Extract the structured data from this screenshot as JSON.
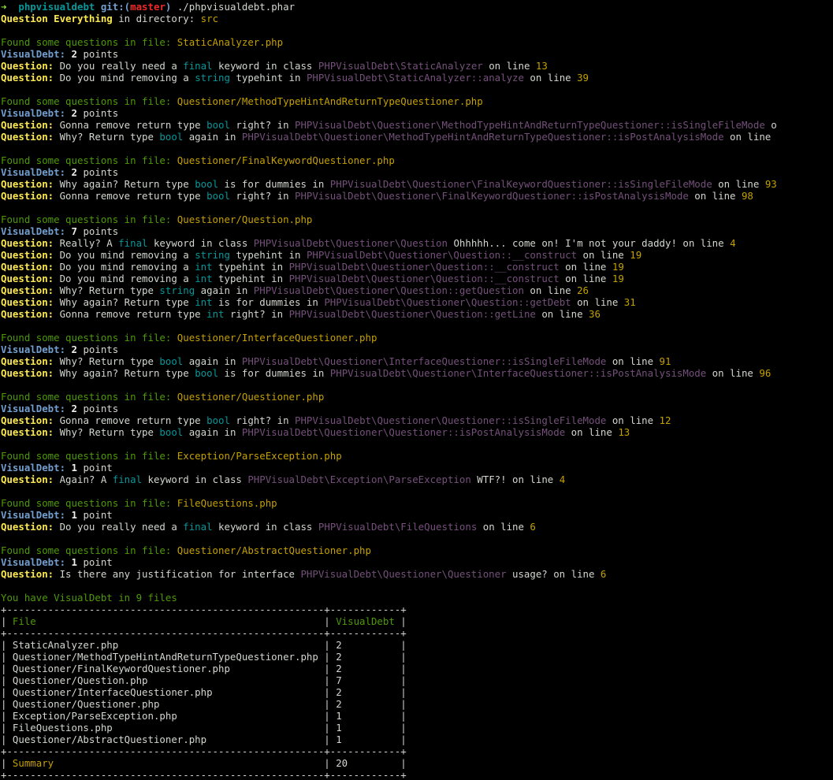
{
  "colors": {
    "background": "#000000",
    "default": "#d3d7cf",
    "green": "#8ae234",
    "dark_green": "#4e9a06",
    "gold": "#c4a000",
    "yellow": "#fce94f",
    "blue": "#729fcf",
    "cyan": "#06989a",
    "purple": "#75507b",
    "red": "#ef2929",
    "white": "#eeeeec"
  },
  "lines": [
    [
      {
        "t": "➜  ",
        "c": "green",
        "b": true
      },
      {
        "t": "phpvisualdebt",
        "c": "cyan",
        "b": true
      },
      {
        "t": " git:(",
        "c": "blue",
        "b": true
      },
      {
        "t": "master",
        "c": "red",
        "b": true
      },
      {
        "t": ")",
        "c": "blue",
        "b": true
      },
      {
        "t": " ./phpvisualdebt.phar",
        "c": "default"
      }
    ],
    [
      {
        "t": "Question Everything",
        "c": "yellow",
        "b": true
      },
      {
        "t": " in directory: ",
        "c": "default"
      },
      {
        "t": "src",
        "c": "gold"
      }
    ],
    [],
    [
      {
        "t": "Found some questions in file: ",
        "c": "dgreen"
      },
      {
        "t": "StaticAnalyzer.php",
        "c": "gold"
      }
    ],
    [
      {
        "t": "VisualDebt:",
        "c": "blue",
        "b": true
      },
      {
        "t": " ",
        "c": "default"
      },
      {
        "t": "2",
        "c": "white",
        "b": true
      },
      {
        "t": " points",
        "c": "default"
      }
    ],
    [
      {
        "t": "Question:",
        "c": "yellow",
        "b": true
      },
      {
        "t": " Do you really need a ",
        "c": "default"
      },
      {
        "t": "final",
        "c": "cyan"
      },
      {
        "t": " keyword in class ",
        "c": "default"
      },
      {
        "t": "PHPVisualDebt\\StaticAnalyzer",
        "c": "purple"
      },
      {
        "t": " on line ",
        "c": "default"
      },
      {
        "t": "13",
        "c": "gold"
      }
    ],
    [
      {
        "t": "Question:",
        "c": "yellow",
        "b": true
      },
      {
        "t": " Do you mind removing a ",
        "c": "default"
      },
      {
        "t": "string",
        "c": "cyan"
      },
      {
        "t": " typehint in ",
        "c": "default"
      },
      {
        "t": "PHPVisualDebt\\StaticAnalyzer::analyze",
        "c": "purple"
      },
      {
        "t": " on line ",
        "c": "default"
      },
      {
        "t": "39",
        "c": "gold"
      }
    ],
    [],
    [
      {
        "t": "Found some questions in file: ",
        "c": "dgreen"
      },
      {
        "t": "Questioner/MethodTypeHintAndReturnTypeQuestioner.php",
        "c": "gold"
      }
    ],
    [
      {
        "t": "VisualDebt:",
        "c": "blue",
        "b": true
      },
      {
        "t": " ",
        "c": "default"
      },
      {
        "t": "2",
        "c": "white",
        "b": true
      },
      {
        "t": " points",
        "c": "default"
      }
    ],
    [
      {
        "t": "Question:",
        "c": "yellow",
        "b": true
      },
      {
        "t": " Gonna remove return type ",
        "c": "default"
      },
      {
        "t": "bool",
        "c": "cyan"
      },
      {
        "t": " right? in ",
        "c": "default"
      },
      {
        "t": "PHPVisualDebt\\Questioner\\MethodTypeHintAndReturnTypeQuestioner::isSingleFileMode",
        "c": "purple"
      },
      {
        "t": " o",
        "c": "default"
      }
    ],
    [
      {
        "t": "Question:",
        "c": "yellow",
        "b": true
      },
      {
        "t": " Why? Return type ",
        "c": "default"
      },
      {
        "t": "bool",
        "c": "cyan"
      },
      {
        "t": " again in ",
        "c": "default"
      },
      {
        "t": "PHPVisualDebt\\Questioner\\MethodTypeHintAndReturnTypeQuestioner::isPostAnalysisMode",
        "c": "purple"
      },
      {
        "t": " on line",
        "c": "default"
      }
    ],
    [],
    [
      {
        "t": "Found some questions in file: ",
        "c": "dgreen"
      },
      {
        "t": "Questioner/FinalKeywordQuestioner.php",
        "c": "gold"
      }
    ],
    [
      {
        "t": "VisualDebt:",
        "c": "blue",
        "b": true
      },
      {
        "t": " ",
        "c": "default"
      },
      {
        "t": "2",
        "c": "white",
        "b": true
      },
      {
        "t": " points",
        "c": "default"
      }
    ],
    [
      {
        "t": "Question:",
        "c": "yellow",
        "b": true
      },
      {
        "t": " Why again? Return type ",
        "c": "default"
      },
      {
        "t": "bool",
        "c": "cyan"
      },
      {
        "t": " is for dummies in ",
        "c": "default"
      },
      {
        "t": "PHPVisualDebt\\Questioner\\FinalKeywordQuestioner::isSingleFileMode",
        "c": "purple"
      },
      {
        "t": " on line ",
        "c": "default"
      },
      {
        "t": "93",
        "c": "gold"
      }
    ],
    [
      {
        "t": "Question:",
        "c": "yellow",
        "b": true
      },
      {
        "t": " Gonna remove return type ",
        "c": "default"
      },
      {
        "t": "bool",
        "c": "cyan"
      },
      {
        "t": " right? in ",
        "c": "default"
      },
      {
        "t": "PHPVisualDebt\\Questioner\\FinalKeywordQuestioner::isPostAnalysisMode",
        "c": "purple"
      },
      {
        "t": " on line ",
        "c": "default"
      },
      {
        "t": "98",
        "c": "gold"
      }
    ],
    [],
    [
      {
        "t": "Found some questions in file: ",
        "c": "dgreen"
      },
      {
        "t": "Questioner/Question.php",
        "c": "gold"
      }
    ],
    [
      {
        "t": "VisualDebt:",
        "c": "blue",
        "b": true
      },
      {
        "t": " ",
        "c": "default"
      },
      {
        "t": "7",
        "c": "white",
        "b": true
      },
      {
        "t": " points",
        "c": "default"
      }
    ],
    [
      {
        "t": "Question:",
        "c": "yellow",
        "b": true
      },
      {
        "t": " Really? A ",
        "c": "default"
      },
      {
        "t": "final",
        "c": "cyan"
      },
      {
        "t": " keyword in class ",
        "c": "default"
      },
      {
        "t": "PHPVisualDebt\\Questioner\\Question",
        "c": "purple"
      },
      {
        "t": " Ohhhhh... come on! I'm not your daddy! on line ",
        "c": "default"
      },
      {
        "t": "4",
        "c": "gold"
      }
    ],
    [
      {
        "t": "Question:",
        "c": "yellow",
        "b": true
      },
      {
        "t": " Do you mind removing a ",
        "c": "default"
      },
      {
        "t": "string",
        "c": "cyan"
      },
      {
        "t": " typehint in ",
        "c": "default"
      },
      {
        "t": "PHPVisualDebt\\Questioner\\Question::__construct",
        "c": "purple"
      },
      {
        "t": " on line ",
        "c": "default"
      },
      {
        "t": "19",
        "c": "gold"
      }
    ],
    [
      {
        "t": "Question:",
        "c": "yellow",
        "b": true
      },
      {
        "t": " Do you mind removing a ",
        "c": "default"
      },
      {
        "t": "int",
        "c": "cyan"
      },
      {
        "t": " typehint in ",
        "c": "default"
      },
      {
        "t": "PHPVisualDebt\\Questioner\\Question::__construct",
        "c": "purple"
      },
      {
        "t": " on line ",
        "c": "default"
      },
      {
        "t": "19",
        "c": "gold"
      }
    ],
    [
      {
        "t": "Question:",
        "c": "yellow",
        "b": true
      },
      {
        "t": " Do you mind removing a ",
        "c": "default"
      },
      {
        "t": "int",
        "c": "cyan"
      },
      {
        "t": " typehint in ",
        "c": "default"
      },
      {
        "t": "PHPVisualDebt\\Questioner\\Question::__construct",
        "c": "purple"
      },
      {
        "t": " on line ",
        "c": "default"
      },
      {
        "t": "19",
        "c": "gold"
      }
    ],
    [
      {
        "t": "Question:",
        "c": "yellow",
        "b": true
      },
      {
        "t": " Why? Return type ",
        "c": "default"
      },
      {
        "t": "string",
        "c": "cyan"
      },
      {
        "t": " again in ",
        "c": "default"
      },
      {
        "t": "PHPVisualDebt\\Questioner\\Question::getQuestion",
        "c": "purple"
      },
      {
        "t": " on line ",
        "c": "default"
      },
      {
        "t": "26",
        "c": "gold"
      }
    ],
    [
      {
        "t": "Question:",
        "c": "yellow",
        "b": true
      },
      {
        "t": " Why again? Return type ",
        "c": "default"
      },
      {
        "t": "int",
        "c": "cyan"
      },
      {
        "t": " is for dummies in ",
        "c": "default"
      },
      {
        "t": "PHPVisualDebt\\Questioner\\Question::getDebt",
        "c": "purple"
      },
      {
        "t": " on line ",
        "c": "default"
      },
      {
        "t": "31",
        "c": "gold"
      }
    ],
    [
      {
        "t": "Question:",
        "c": "yellow",
        "b": true
      },
      {
        "t": " Gonna remove return type ",
        "c": "default"
      },
      {
        "t": "int",
        "c": "cyan"
      },
      {
        "t": " right? in ",
        "c": "default"
      },
      {
        "t": "PHPVisualDebt\\Questioner\\Question::getLine",
        "c": "purple"
      },
      {
        "t": " on line ",
        "c": "default"
      },
      {
        "t": "36",
        "c": "gold"
      }
    ],
    [],
    [
      {
        "t": "Found some questions in file: ",
        "c": "dgreen"
      },
      {
        "t": "Questioner/InterfaceQuestioner.php",
        "c": "gold"
      }
    ],
    [
      {
        "t": "VisualDebt:",
        "c": "blue",
        "b": true
      },
      {
        "t": " ",
        "c": "default"
      },
      {
        "t": "2",
        "c": "white",
        "b": true
      },
      {
        "t": " points",
        "c": "default"
      }
    ],
    [
      {
        "t": "Question:",
        "c": "yellow",
        "b": true
      },
      {
        "t": " Why? Return type ",
        "c": "default"
      },
      {
        "t": "bool",
        "c": "cyan"
      },
      {
        "t": " again in ",
        "c": "default"
      },
      {
        "t": "PHPVisualDebt\\Questioner\\InterfaceQuestioner::isSingleFileMode",
        "c": "purple"
      },
      {
        "t": " on line ",
        "c": "default"
      },
      {
        "t": "91",
        "c": "gold"
      }
    ],
    [
      {
        "t": "Question:",
        "c": "yellow",
        "b": true
      },
      {
        "t": " Why again? Return type ",
        "c": "default"
      },
      {
        "t": "bool",
        "c": "cyan"
      },
      {
        "t": " is for dummies in ",
        "c": "default"
      },
      {
        "t": "PHPVisualDebt\\Questioner\\InterfaceQuestioner::isPostAnalysisMode",
        "c": "purple"
      },
      {
        "t": " on line ",
        "c": "default"
      },
      {
        "t": "96",
        "c": "gold"
      }
    ],
    [],
    [
      {
        "t": "Found some questions in file: ",
        "c": "dgreen"
      },
      {
        "t": "Questioner/Questioner.php",
        "c": "gold"
      }
    ],
    [
      {
        "t": "VisualDebt:",
        "c": "blue",
        "b": true
      },
      {
        "t": " ",
        "c": "default"
      },
      {
        "t": "2",
        "c": "white",
        "b": true
      },
      {
        "t": " points",
        "c": "default"
      }
    ],
    [
      {
        "t": "Question:",
        "c": "yellow",
        "b": true
      },
      {
        "t": " Gonna remove return type ",
        "c": "default"
      },
      {
        "t": "bool",
        "c": "cyan"
      },
      {
        "t": " right? in ",
        "c": "default"
      },
      {
        "t": "PHPVisualDebt\\Questioner\\Questioner::isSingleFileMode",
        "c": "purple"
      },
      {
        "t": " on line ",
        "c": "default"
      },
      {
        "t": "12",
        "c": "gold"
      }
    ],
    [
      {
        "t": "Question:",
        "c": "yellow",
        "b": true
      },
      {
        "t": " Why? Return type ",
        "c": "default"
      },
      {
        "t": "bool",
        "c": "cyan"
      },
      {
        "t": " again in ",
        "c": "default"
      },
      {
        "t": "PHPVisualDebt\\Questioner\\Questioner::isPostAnalysisMode",
        "c": "purple"
      },
      {
        "t": " on line ",
        "c": "default"
      },
      {
        "t": "13",
        "c": "gold"
      }
    ],
    [],
    [
      {
        "t": "Found some questions in file: ",
        "c": "dgreen"
      },
      {
        "t": "Exception/ParseException.php",
        "c": "gold"
      }
    ],
    [
      {
        "t": "VisualDebt:",
        "c": "blue",
        "b": true
      },
      {
        "t": " ",
        "c": "default"
      },
      {
        "t": "1",
        "c": "white",
        "b": true
      },
      {
        "t": " point",
        "c": "default"
      }
    ],
    [
      {
        "t": "Question:",
        "c": "yellow",
        "b": true
      },
      {
        "t": " Again? A ",
        "c": "default"
      },
      {
        "t": "final",
        "c": "cyan"
      },
      {
        "t": " keyword in class ",
        "c": "default"
      },
      {
        "t": "PHPVisualDebt\\Exception\\ParseException",
        "c": "purple"
      },
      {
        "t": " WTF?! on line ",
        "c": "default"
      },
      {
        "t": "4",
        "c": "gold"
      }
    ],
    [],
    [
      {
        "t": "Found some questions in file: ",
        "c": "dgreen"
      },
      {
        "t": "FileQuestions.php",
        "c": "gold"
      }
    ],
    [
      {
        "t": "VisualDebt:",
        "c": "blue",
        "b": true
      },
      {
        "t": " ",
        "c": "default"
      },
      {
        "t": "1",
        "c": "white",
        "b": true
      },
      {
        "t": " point",
        "c": "default"
      }
    ],
    [
      {
        "t": "Question:",
        "c": "yellow",
        "b": true
      },
      {
        "t": " Do you really need a ",
        "c": "default"
      },
      {
        "t": "final",
        "c": "cyan"
      },
      {
        "t": " keyword in class ",
        "c": "default"
      },
      {
        "t": "PHPVisualDebt\\FileQuestions",
        "c": "purple"
      },
      {
        "t": " on line ",
        "c": "default"
      },
      {
        "t": "6",
        "c": "gold"
      }
    ],
    [],
    [
      {
        "t": "Found some questions in file: ",
        "c": "dgreen"
      },
      {
        "t": "Questioner/AbstractQuestioner.php",
        "c": "gold"
      }
    ],
    [
      {
        "t": "VisualDebt:",
        "c": "blue",
        "b": true
      },
      {
        "t": " ",
        "c": "default"
      },
      {
        "t": "1",
        "c": "white",
        "b": true
      },
      {
        "t": " point",
        "c": "default"
      }
    ],
    [
      {
        "t": "Question:",
        "c": "yellow",
        "b": true
      },
      {
        "t": " Is there any justification for interface ",
        "c": "default"
      },
      {
        "t": "PHPVisualDebt\\Questioner\\Questioner",
        "c": "purple"
      },
      {
        "t": " usage? on line ",
        "c": "default"
      },
      {
        "t": "6",
        "c": "gold"
      }
    ],
    [],
    [
      {
        "t": "You have VisualDebt in 9 files",
        "c": "dgreen"
      }
    ],
    [
      {
        "t": "+------------------------------------------------------+------------+",
        "c": "default"
      }
    ],
    [
      {
        "t": "| ",
        "c": "default"
      },
      {
        "t": "File                                                 ",
        "c": "dgreen"
      },
      {
        "t": "| ",
        "c": "default"
      },
      {
        "t": "VisualDebt ",
        "c": "dgreen"
      },
      {
        "t": "|",
        "c": "default"
      }
    ],
    [
      {
        "t": "+------------------------------------------------------+------------+",
        "c": "default"
      }
    ],
    [
      {
        "t": "| StaticAnalyzer.php                                   | 2          |",
        "c": "default"
      }
    ],
    [
      {
        "t": "| Questioner/MethodTypeHintAndReturnTypeQuestioner.php | 2          |",
        "c": "default"
      }
    ],
    [
      {
        "t": "| Questioner/FinalKeywordQuestioner.php                | 2          |",
        "c": "default"
      }
    ],
    [
      {
        "t": "| Questioner/Question.php                              | 7          |",
        "c": "default"
      }
    ],
    [
      {
        "t": "| Questioner/InterfaceQuestioner.php                   | 2          |",
        "c": "default"
      }
    ],
    [
      {
        "t": "| Questioner/Questioner.php                            | 2          |",
        "c": "default"
      }
    ],
    [
      {
        "t": "| Exception/ParseException.php                         | 1          |",
        "c": "default"
      }
    ],
    [
      {
        "t": "| FileQuestions.php                                    | 1          |",
        "c": "default"
      }
    ],
    [
      {
        "t": "| Questioner/AbstractQuestioner.php                    | 1          |",
        "c": "default"
      }
    ],
    [
      {
        "t": "+------------------------------------------------------+------------+",
        "c": "default"
      }
    ],
    [
      {
        "t": "| ",
        "c": "default"
      },
      {
        "t": "Summary                                              ",
        "c": "gold"
      },
      {
        "t": "| ",
        "c": "default"
      },
      {
        "t": "20",
        "c": "default"
      },
      {
        "t": "         |",
        "c": "default"
      }
    ],
    [
      {
        "t": "+------------------------------------------------------+------------+",
        "c": "default"
      }
    ]
  ]
}
